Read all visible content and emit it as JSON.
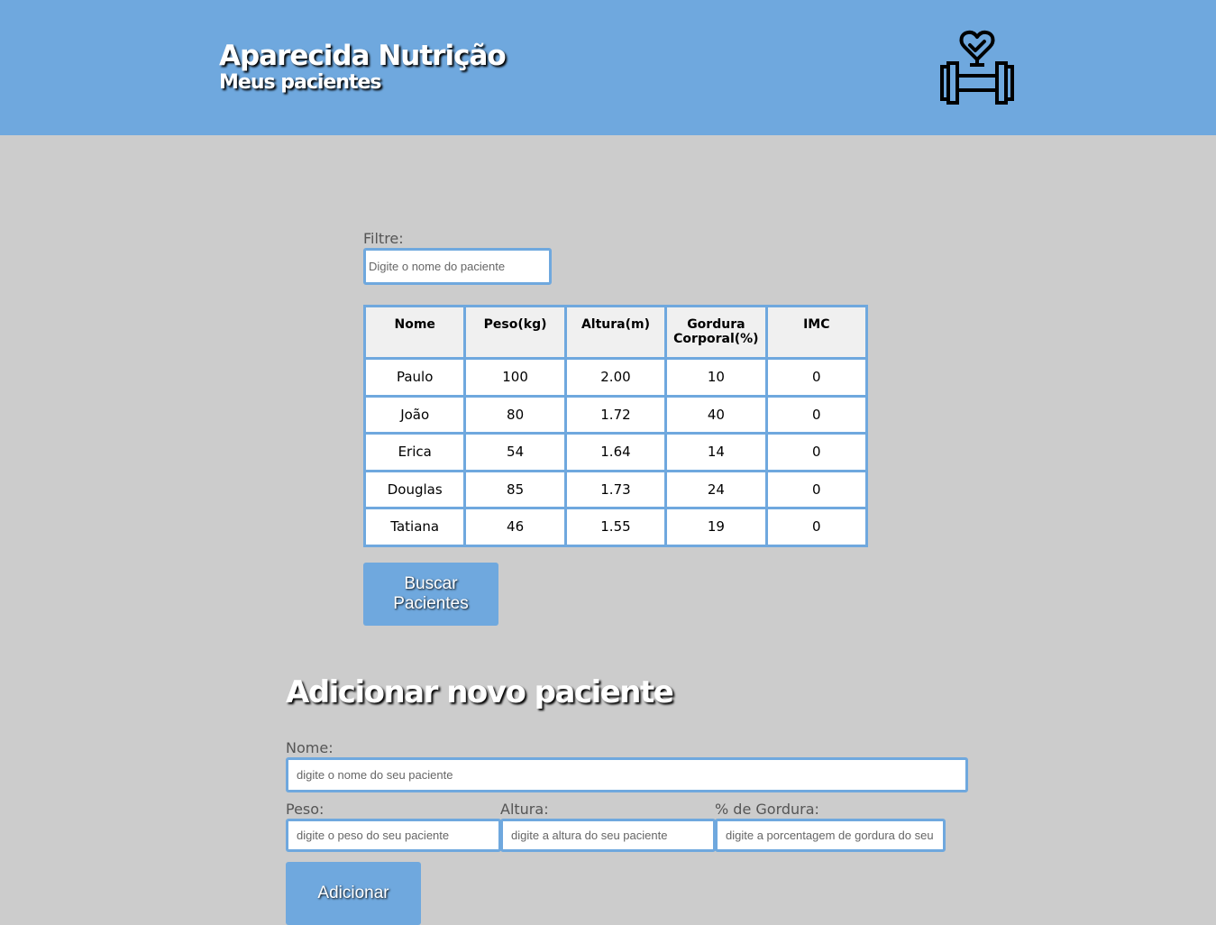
{
  "header": {
    "title": "Aparecida Nutrição",
    "subtitle": "Meus pacientes",
    "logo_icon": "heart-dumbbell-icon",
    "background": "#6fa8de"
  },
  "filter": {
    "label": "Filtre:",
    "placeholder": "Digite o nome do paciente"
  },
  "table": {
    "headers": [
      "Nome",
      "Peso(kg)",
      "Altura(m)",
      "Gordura Corporal(%)",
      "IMC"
    ],
    "rows": [
      [
        "Paulo",
        "100",
        "2.00",
        "10",
        "0"
      ],
      [
        "João",
        "80",
        "1.72",
        "40",
        "0"
      ],
      [
        "Erica",
        "54",
        "1.64",
        "14",
        "0"
      ],
      [
        "Douglas",
        "85",
        "1.73",
        "24",
        "0"
      ],
      [
        "Tatiana",
        "46",
        "1.55",
        "19",
        "0"
      ]
    ]
  },
  "search_button": "Buscar Pacientes",
  "form": {
    "title": "Adicionar novo paciente",
    "nome": {
      "label": "Nome:",
      "placeholder": "digite o nome do seu paciente"
    },
    "peso": {
      "label": "Peso:",
      "placeholder": "digite o peso do seu paciente"
    },
    "altura": {
      "label": "Altura:",
      "placeholder": "digite a altura do seu paciente"
    },
    "gordura": {
      "label": "% de Gordura:",
      "placeholder": "digite a porcentagem de gordura do seu paciente"
    },
    "submit": "Adicionar"
  },
  "colors": {
    "accent": "#6fa8de",
    "page_background": "#cccccc"
  }
}
